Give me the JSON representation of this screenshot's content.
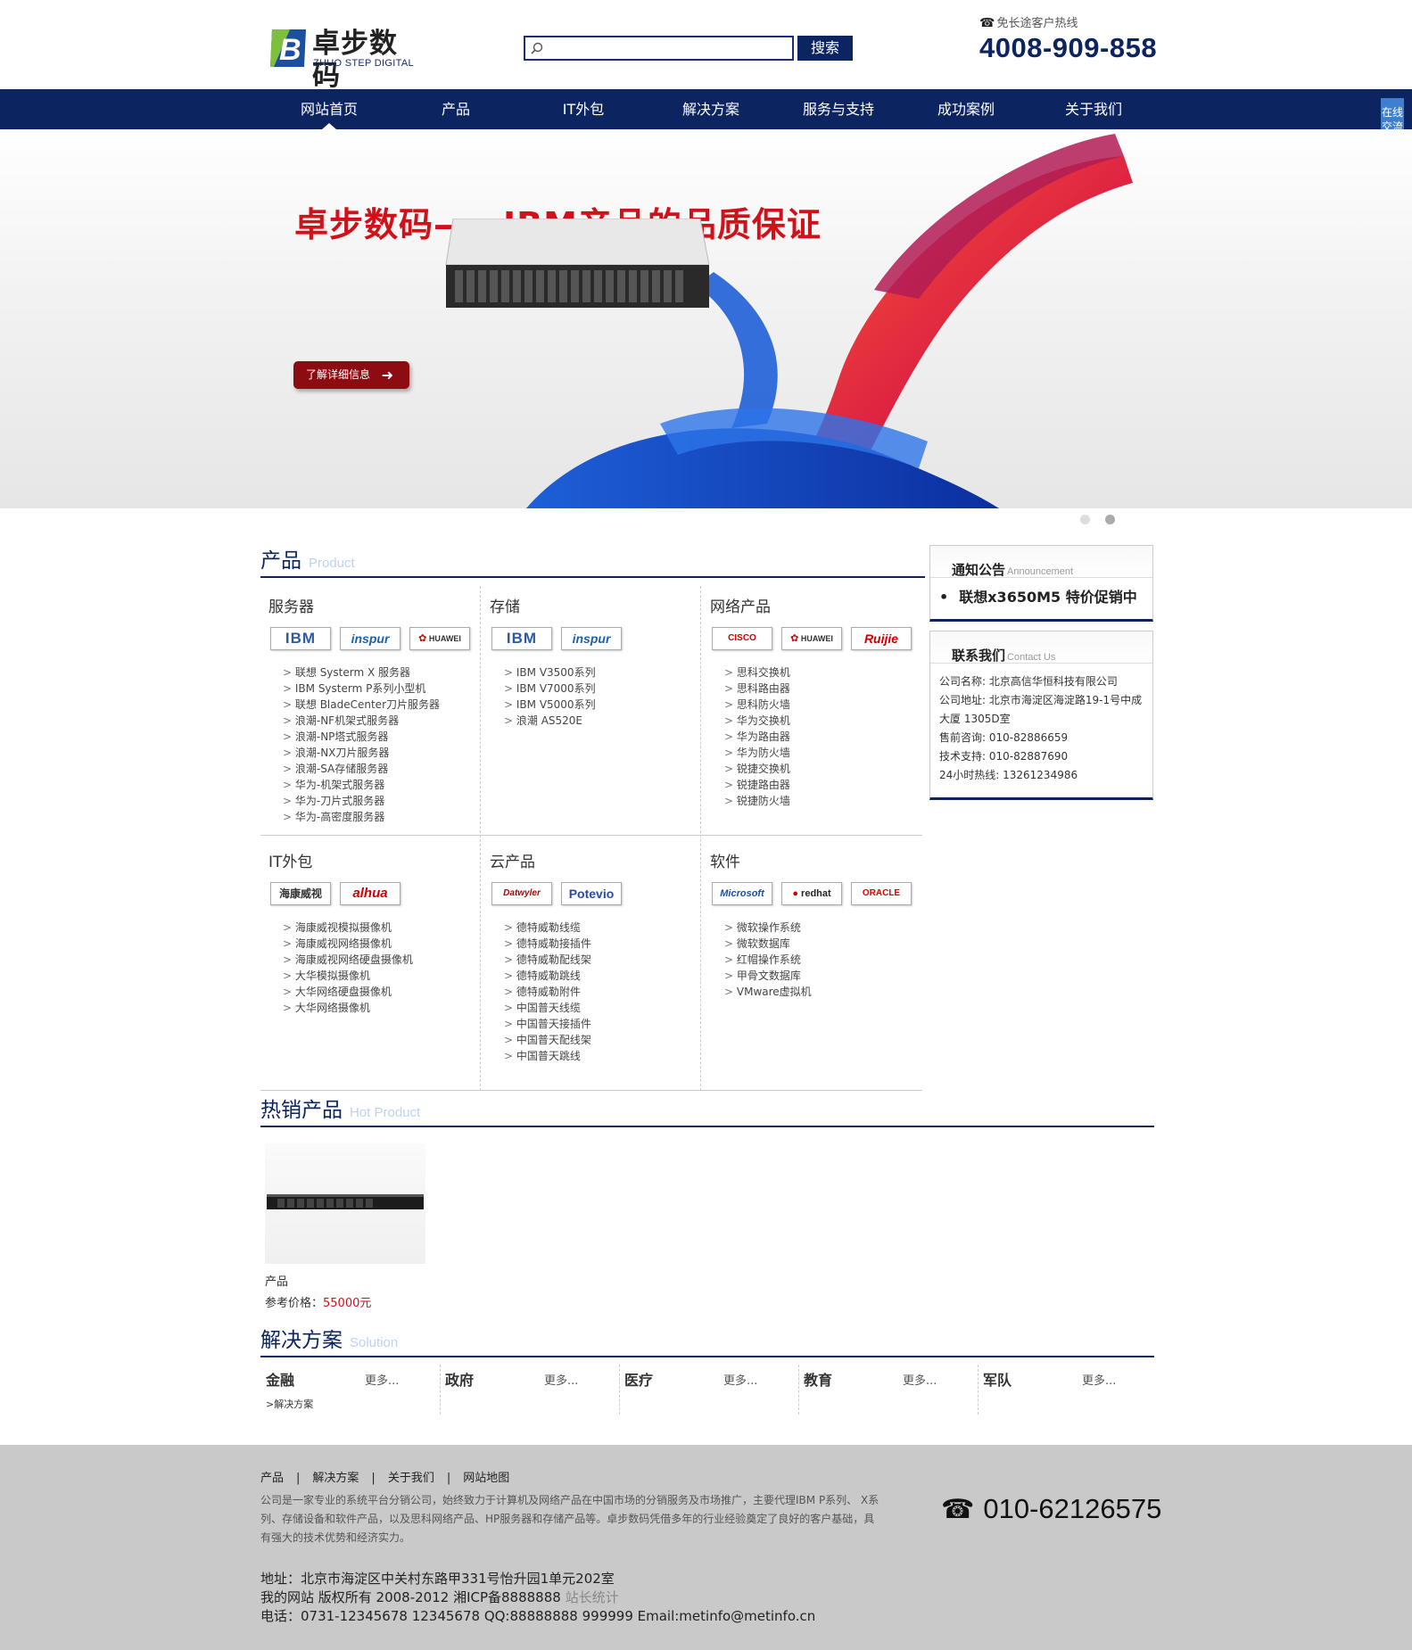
{
  "header": {
    "logo_name": "卓步数码",
    "logo_sub": "ZHUO STEP DIGITAL",
    "search_placeholder": "",
    "search_button": "搜索",
    "hotline_label": "免长途客户热线",
    "hotline_number": "4008-909-858"
  },
  "nav": {
    "items": [
      "网站首页",
      "产品",
      "IT外包",
      "解决方案",
      "服务与支持",
      "成功案例",
      "关于我们"
    ],
    "active_index": 0
  },
  "side_chat": "在线交流",
  "banner": {
    "headline": "卓步数码——IBM产品的品质保证",
    "cta": "了解详细信息",
    "slides": 2,
    "active_slide": 1
  },
  "products": {
    "title": "产品",
    "title_en": "Product",
    "cells": [
      {
        "title": "服务器",
        "brands": [
          "IBM",
          "inspur",
          "HUAWEI"
        ],
        "items": [
          "联想 Systerm X 服务器",
          "IBM Systerm P系列小型机",
          "联想 BladeCenter刀片服务器",
          "浪潮-NF机架式服务器",
          "浪潮-NP塔式服务器",
          "浪潮-NX刀片服务器",
          "浪潮-SA存储服务器",
          "华为-机架式服务器",
          "华为-刀片式服务器",
          "华为-高密度服务器"
        ]
      },
      {
        "title": "存储",
        "brands": [
          "IBM",
          "inspur"
        ],
        "items": [
          "IBM V3500系列",
          "IBM V7000系列",
          "IBM V5000系列",
          "浪潮 AS520E"
        ]
      },
      {
        "title": "网络产品",
        "brands": [
          "CISCO",
          "HUAWEI",
          "Ruijie"
        ],
        "items": [
          "思科交换机",
          "思科路由器",
          "思科防火墙",
          "华为交换机",
          "华为路由器",
          "华为防火墙",
          "锐捷交换机",
          "锐捷路由器",
          "锐捷防火墙"
        ]
      },
      {
        "title": "IT外包",
        "brands": [
          "海康威视",
          "alhua"
        ],
        "items": [
          "海康威视模拟摄像机",
          "海康威视网络摄像机",
          "海康威视网络硬盘摄像机",
          "大华模拟摄像机",
          "大华网络硬盘摄像机",
          "大华网络摄像机"
        ]
      },
      {
        "title": "云产品",
        "brands": [
          "Datwyler",
          "Potevio"
        ],
        "items": [
          "德特威勒线缆",
          "德特威勒接插件",
          "德特威勒配线架",
          "德特威勒跳线",
          "德特威勒附件",
          "中国普天线缆",
          "中国普天接插件",
          "中国普天配线架",
          "中国普天跳线"
        ]
      },
      {
        "title": "软件",
        "brands": [
          "Microsoft",
          "redhat",
          "ORACLE"
        ],
        "items": [
          "微软操作系统",
          "微软数据库",
          "红帽操作系统",
          "甲骨文数据库",
          "VMware虚拟机"
        ]
      }
    ]
  },
  "sidebar": {
    "notice_title": "通知公告",
    "notice_title_en": "Announcement",
    "notice_item": "联想x3650M5 特价促销中",
    "contact_title": "联系我们",
    "contact_title_en": "Contact Us",
    "contact_lines": [
      "公司名称: 北京高信华恒科技有限公司",
      "公司地址: 北京市海淀区海淀路19-1号中成大厦 1305D室",
      "售前咨询: 010-82886659",
      "技术支持: 010-82887690",
      "24小时热线: 13261234986"
    ]
  },
  "hot": {
    "title": "热销产品",
    "title_en": "Hot Product",
    "name": "产品",
    "price_label": "参考价格：",
    "price": "55000元"
  },
  "solutions": {
    "title": "解决方案",
    "title_en": "Solution",
    "more": "更多...",
    "items": [
      "金融",
      "政府",
      "医疗",
      "教育",
      "军队"
    ],
    "first_sub": ">解决方案"
  },
  "footer": {
    "links": [
      "产品",
      "解决方案",
      "关于我们",
      "网站地图"
    ],
    "desc": "公司是一家专业的系统平台分销公司，始终致力于计算机及网络产品在中国市场的分销服务及市场推广，主要代理IBM P系列、 X系列、存储设备和软件产品，以及思科网络产品、HP服务器和存储产品等。卓步数码凭借多年的行业经验奠定了良好的客户基础，具有强大的技术优势和经济实力。",
    "phone": "010-62126575",
    "address": "地址：北京市海淀区中关村东路甲331号怡升园1单元202室",
    "copyright": "我的网站 版权所有 2008-2012 湘ICP备8888888",
    "stats": "站长统计",
    "contact": "电话：0731-12345678 12345678 QQ:88888888 999999 Email:metinfo@metinfo.cn"
  },
  "colors": {
    "brand_blue": "#0c2560",
    "accent_red": "#d0111a"
  }
}
